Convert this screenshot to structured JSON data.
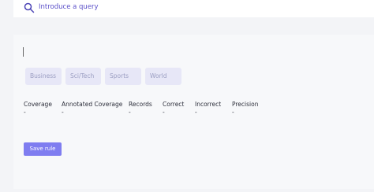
{
  "search": {
    "placeholder": "Introduce a query",
    "icon": "search-icon"
  },
  "labels": [
    "Business",
    "Sci/Tech",
    "Sports",
    "World"
  ],
  "metrics": {
    "headers": [
      "Coverage",
      "Annotated Coverage",
      "Records",
      "Correct",
      "Incorrect",
      "Precision"
    ],
    "values": [
      "-",
      "-",
      "-",
      "-",
      "-",
      "-"
    ]
  },
  "actions": {
    "save_label": "Save rule"
  },
  "colors": {
    "accent": "#7f7df0",
    "chip": "#e7e7f7",
    "chip_text": "#9b9ec2",
    "link": "#5b50c9"
  }
}
